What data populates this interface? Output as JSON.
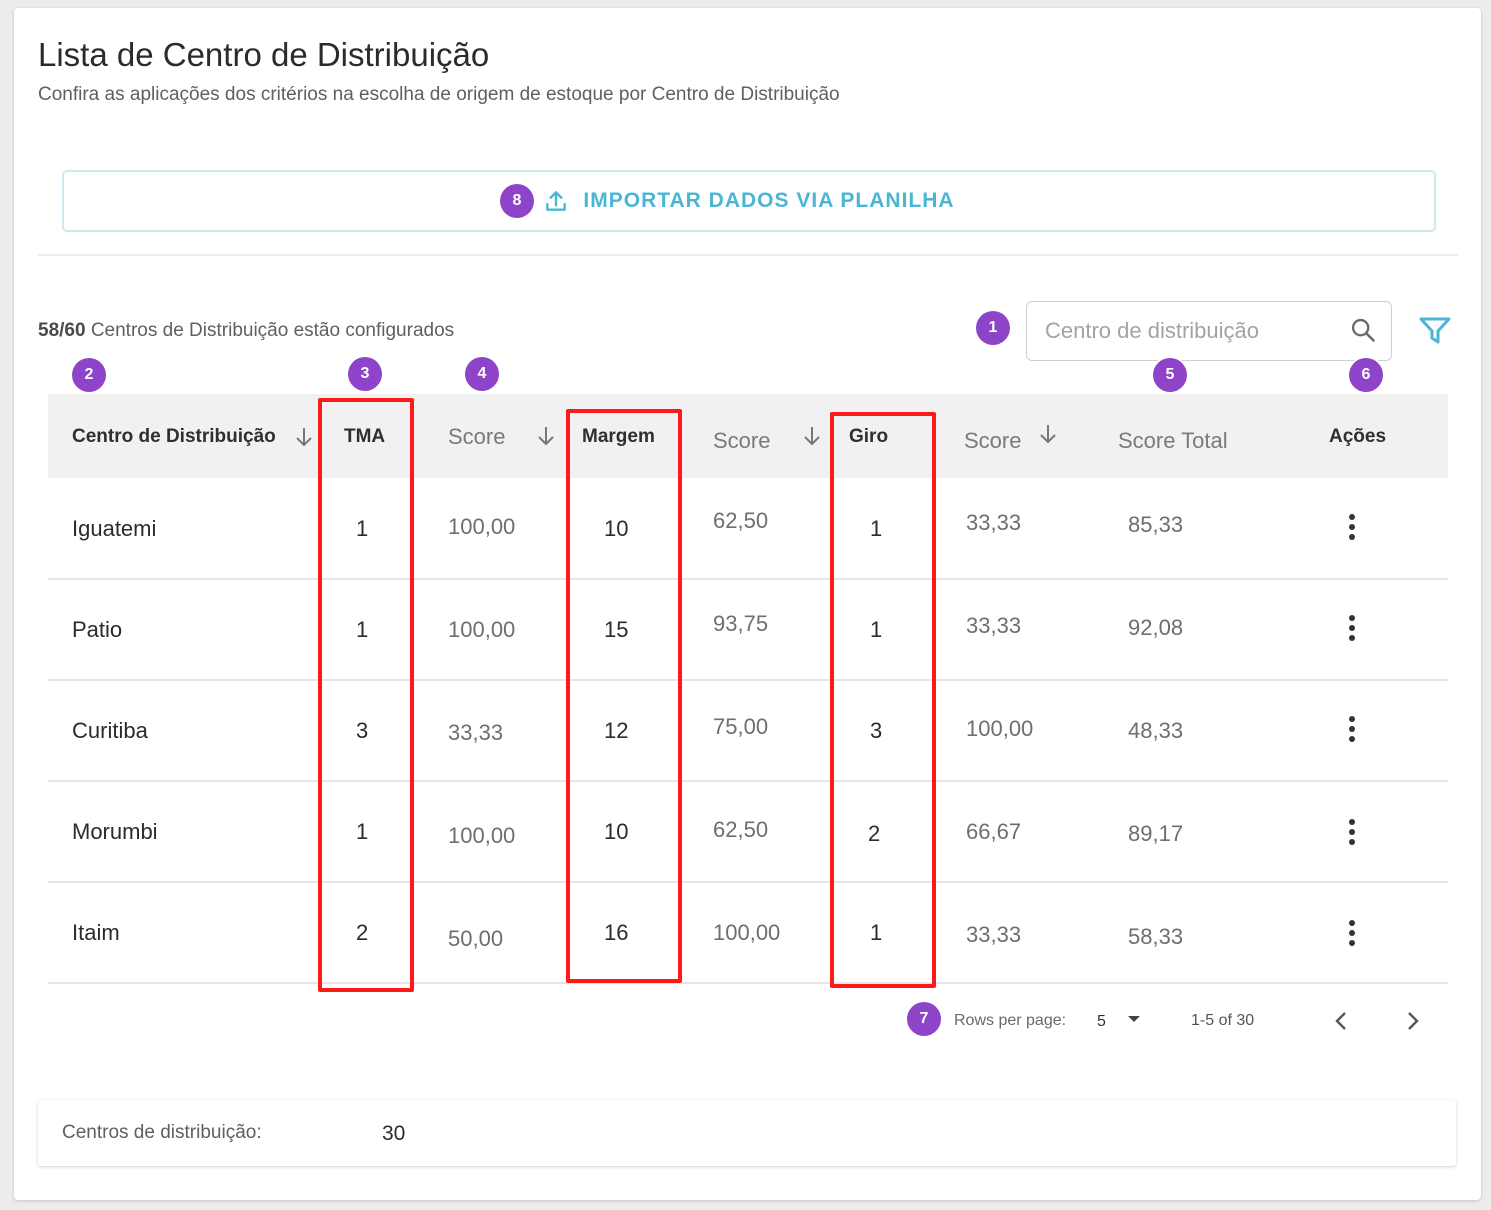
{
  "header": {
    "title": "Lista de Centro de Distribuição",
    "subtitle": "Confira as aplicações dos critérios na escolha de origem de estoque por Centro de Distribuição"
  },
  "import_button": {
    "label": "IMPORTAR DADOS VIA PLANILHA",
    "icon": "upload-icon"
  },
  "configured": {
    "count": "58/60",
    "text": "Centros de Distribuição estão configurados"
  },
  "search": {
    "placeholder": "Centro de distribuição",
    "value": "",
    "icon": "search-icon"
  },
  "filter": {
    "icon": "filter-icon"
  },
  "table": {
    "columns": [
      "Centro de Distribuição",
      "TMA",
      "Score",
      "Margem",
      "Score",
      "Giro",
      "Score",
      "Score Total",
      "Ações"
    ],
    "rows": [
      {
        "cd": "Iguatemi",
        "tma": "1",
        "tma_score": "100,00",
        "margem": "10",
        "margem_score": "62,50",
        "giro": "1",
        "giro_score": "33,33",
        "total": "85,33"
      },
      {
        "cd": "Patio",
        "tma": "1",
        "tma_score": "100,00",
        "margem": "15",
        "margem_score": "93,75",
        "giro": "1",
        "giro_score": "33,33",
        "total": "92,08"
      },
      {
        "cd": "Curitiba",
        "tma": "3",
        "tma_score": "33,33",
        "margem": "12",
        "margem_score": "75,00",
        "giro": "3",
        "giro_score": "100,00",
        "total": "48,33"
      },
      {
        "cd": "Morumbi",
        "tma": "1",
        "tma_score": "100,00",
        "margem": "10",
        "margem_score": "62,50",
        "giro": "2",
        "giro_score": "66,67",
        "total": "89,17"
      },
      {
        "cd": "Itaim",
        "tma": "2",
        "tma_score": "50,00",
        "margem": "16",
        "margem_score": "100,00",
        "giro": "1",
        "giro_score": "33,33",
        "total": "58,33"
      }
    ]
  },
  "pagination": {
    "rows_per_page_label": "Rows per page:",
    "rows_per_page": "5",
    "range": "1-5 of 30"
  },
  "summary": {
    "label": "Centros de distribuição:",
    "value": "30"
  },
  "badges": [
    "1",
    "2",
    "3",
    "4",
    "5",
    "6",
    "7",
    "8"
  ],
  "colors": {
    "accent": "#4bb6d4",
    "badge": "#8e44c8",
    "highlight": "#ff1a1a"
  }
}
